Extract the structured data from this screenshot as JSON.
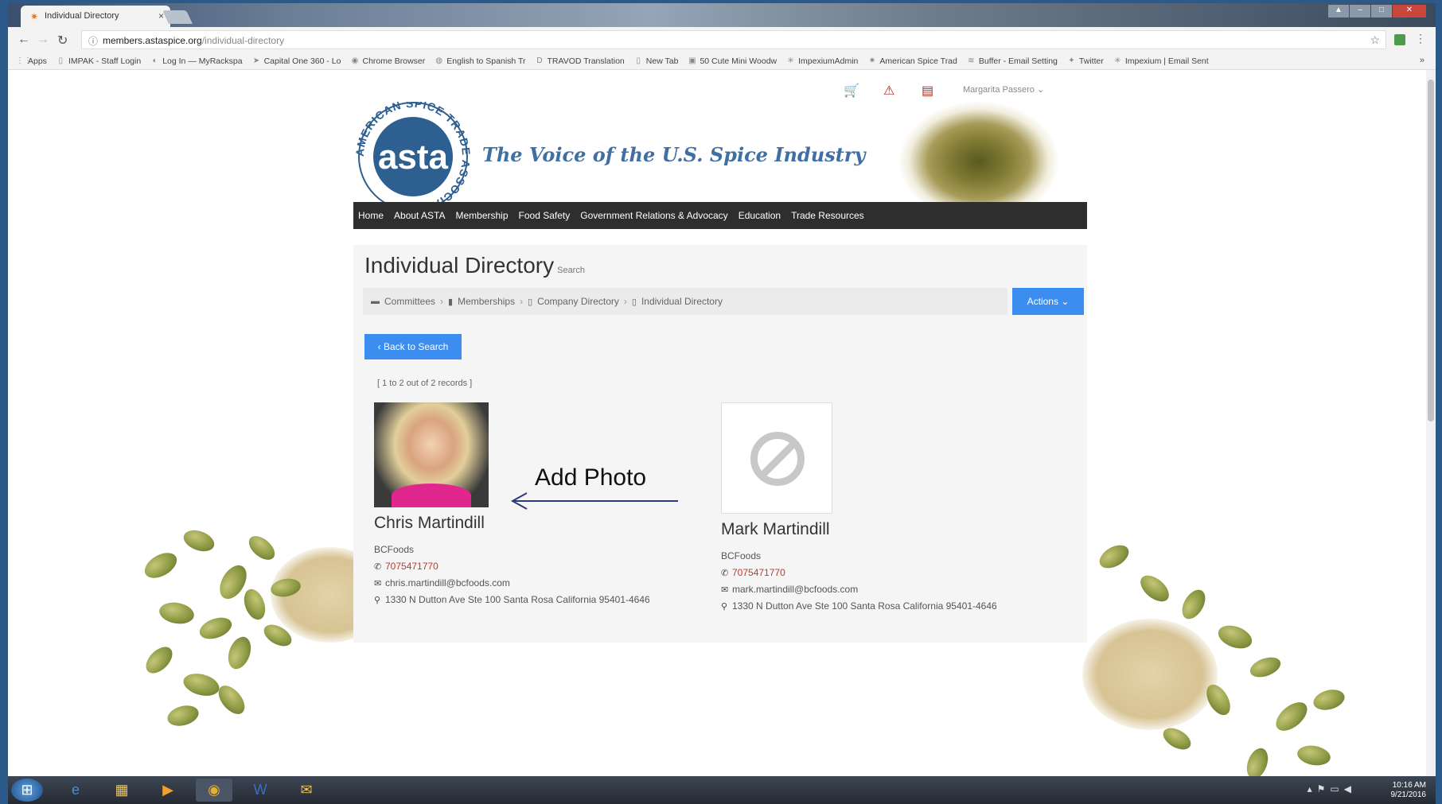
{
  "browser": {
    "tab_title": "Individual Directory",
    "tab_close": "×",
    "url_host": "members.astaspice.org",
    "url_path": "/individual-directory",
    "bookmarks": [
      {
        "label": "Apps",
        "icon": "apps-grid-icon"
      },
      {
        "label": "IMPAK - Staff Login",
        "icon": "page-icon"
      },
      {
        "label": "Log In — MyRackspa",
        "icon": "rackspace-icon"
      },
      {
        "label": "Capital One 360 - Lo",
        "icon": "capital-one-icon"
      },
      {
        "label": "Chrome Browser",
        "icon": "chrome-icon"
      },
      {
        "label": "English to Spanish Tr",
        "icon": "translate-icon"
      },
      {
        "label": "TRAVOD Translation",
        "icon": "travod-icon"
      },
      {
        "label": "New Tab",
        "icon": "page-icon"
      },
      {
        "label": "50 Cute Mini Woodw",
        "icon": "pinterest-icon"
      },
      {
        "label": "ImpexiumAdmin",
        "icon": "impexium-icon"
      },
      {
        "label": "American Spice Trad",
        "icon": "asta-icon"
      },
      {
        "label": "Buffer - Email Setting",
        "icon": "buffer-icon"
      },
      {
        "label": "Twitter",
        "icon": "twitter-icon"
      },
      {
        "label": "Impexium | Email Sent",
        "icon": "impexium-icon"
      }
    ],
    "bookmarks_more": "»"
  },
  "header": {
    "user_name": "Margarita Passero",
    "tagline": "The Voice of the U.S. Spice Industry",
    "logo_text": "asta",
    "logo_ring": "AMERICAN SPICE TRADE ASSOCIATION"
  },
  "nav": {
    "items": [
      "Home",
      "About ASTA",
      "Membership",
      "Food Safety",
      "Government Relations & Advocacy",
      "Education",
      "Trade Resources"
    ]
  },
  "content": {
    "title": "Individual Directory",
    "subtitle": "Search",
    "breadcrumbs": [
      "Committees",
      "Memberships",
      "Company Directory",
      "Individual Directory"
    ],
    "actions_label": "Actions",
    "back_label": "Back to Search",
    "records": "[ 1 to 2 out of 2 records ]",
    "people": [
      {
        "name": "Chris Martindill",
        "company": "BCFoods",
        "phone": "7075471770",
        "email": "chris.martindill@bcfoods.com",
        "address": "1330 N Dutton Ave Ste 100 Santa Rosa California 95401-4646"
      },
      {
        "name": "Mark Martindill",
        "company": "BCFoods",
        "phone": "7075471770",
        "email": "mark.martindill@bcfoods.com",
        "address": "1330 N Dutton Ave Ste 100 Santa Rosa California 95401-4646"
      }
    ]
  },
  "annotation": {
    "text": "Add Photo"
  },
  "taskbar": {
    "time": "10:16 AM",
    "date": "9/21/2016"
  },
  "colors": {
    "accent_blue": "#3b8ef0",
    "nav_dark": "#2e2e2e",
    "brand_blue": "#3f6fa3",
    "alert_red": "#b0291c"
  }
}
